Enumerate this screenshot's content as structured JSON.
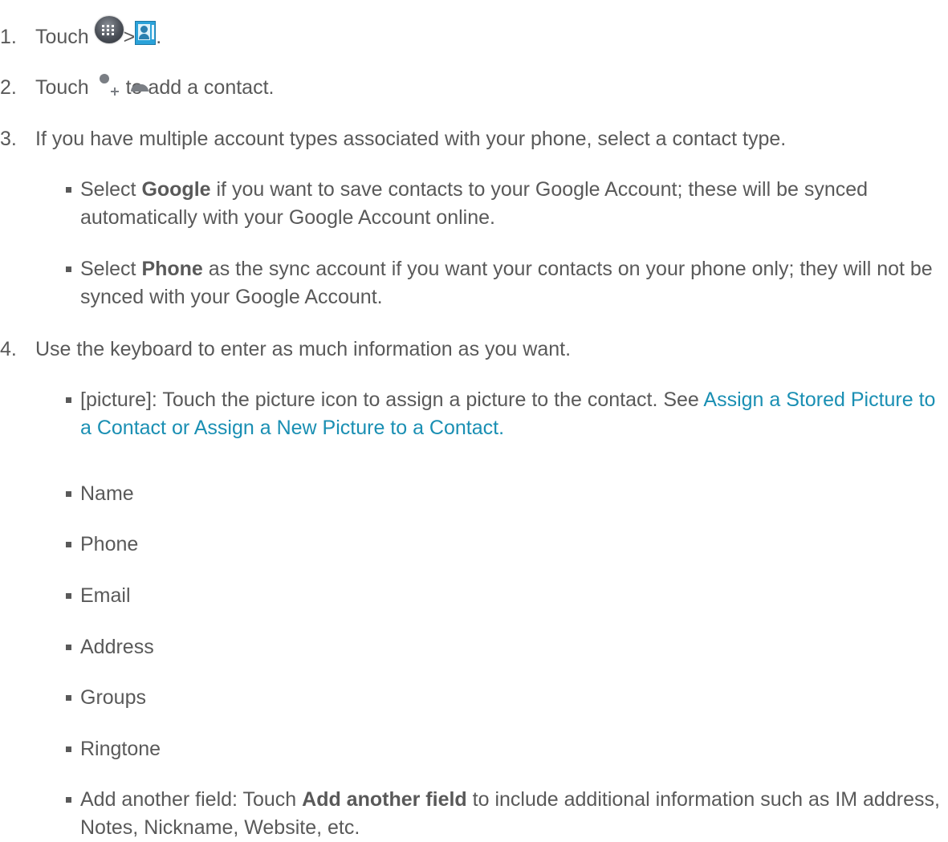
{
  "steps": [
    {
      "number": "1.",
      "pre": "Touch",
      "icon1": "apps-icon",
      "separator": ">",
      "icon2": "contacts-icon",
      "post": "."
    },
    {
      "number": "2.",
      "pre": "Touch",
      "icon": "add-contact-icon",
      "post": "to add a contact."
    },
    {
      "number": "3.",
      "text": "If you have multiple account types associated with your phone, select a contact type.",
      "bullets": [
        {
          "pre": "Select",
          "bold": "Google",
          "post": "if you want to save contacts to your Google Account; these will be synced automatically with your Google Account online."
        },
        {
          "pre": "Select",
          "bold": "Phone",
          "post": "as the sync account if you want your contacts on your phone only; they will not be synced with your Google Account."
        }
      ]
    },
    {
      "number": "4.",
      "text": "Use the keyboard to enter as much information as you want.",
      "picture_bullet": {
        "pre": "[picture]: Touch the picture icon to assign a picture to the contact. See",
        "link": "Assign a Stored Picture to a Contact or Assign a New Picture to a Contact",
        "post": "."
      },
      "fields": [
        "Name",
        "Phone",
        "Email",
        "Address",
        "Groups",
        "Ringtone"
      ],
      "another_field": {
        "pre": "Add another field: Touch",
        "bold": "Add another field",
        "post": "to include additional information such as IM address, Notes, Nickname, Website, etc."
      }
    }
  ],
  "colors": {
    "text": "#595959",
    "link": "#1a8fb3"
  }
}
